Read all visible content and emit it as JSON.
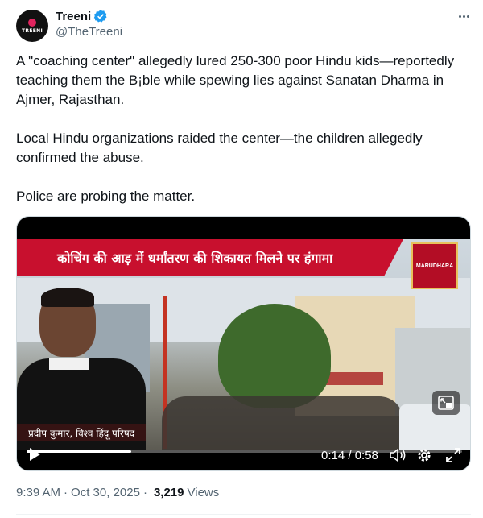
{
  "author": {
    "display_name": "Treeni",
    "handle": "@TheTreeni",
    "avatar_text": "TREENI",
    "verified": true
  },
  "tweet": {
    "paragraphs": [
      "A \"coaching center\" allegedly lured 250-300 poor Hindu kids—reportedly teaching them the B¡ble while spewing lies against Sanatan Dharma in Ajmer, Rajasthan.",
      "Local Hindu organizations raided the center—the children allegedly confirmed the abuse.",
      "Police are probing the matter."
    ]
  },
  "video": {
    "banner_text": "कोचिंग की आड़ में धर्मांतरण की शिकायत मिलने पर हंगामा",
    "channel_logo_text": "MARUDHARA",
    "lower_third": "प्रदीप कुमार, विश्व हिंदू परिषद",
    "time": "0:14 / 0:58",
    "progress": 0.24
  },
  "meta": {
    "time": "9:39 AM",
    "separator": "·",
    "date": "Oct 30, 2025",
    "views_count": "3,219",
    "views_label": "Views"
  },
  "colors": {
    "accent": "#1d9bf0",
    "banner": "#c8102e",
    "text": "#0f1419",
    "muted": "#536471"
  }
}
